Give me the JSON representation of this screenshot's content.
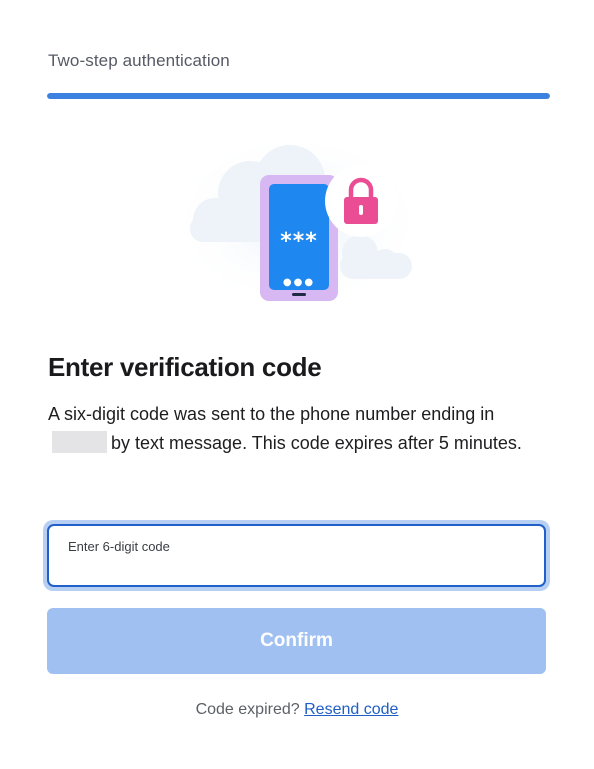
{
  "header": {
    "title": "Two-step authentication",
    "progress": 1.0
  },
  "illustration": {
    "phone_code": "***",
    "phone_dots": "●●●",
    "lock_icon": "lock-icon",
    "colors": {
      "phone_body": "#1e88f0",
      "phone_frame": "#d7b8f3",
      "lock": "#ea4d93",
      "cloud": "#eef3fa"
    }
  },
  "main": {
    "title": "Enter verification code",
    "description_before": "A six-digit code was sent to the phone number ending in",
    "description_after": "by text message. This code expires after 5 minutes."
  },
  "code_field": {
    "label": "Enter 6-digit code",
    "value": ""
  },
  "confirm": {
    "label": "Confirm"
  },
  "resend": {
    "prompt": "Code expired?",
    "link": "Resend code"
  },
  "colors": {
    "accent": "#3b82e0",
    "button_disabled": "#9fc0f0",
    "link": "#1f5fc5"
  }
}
